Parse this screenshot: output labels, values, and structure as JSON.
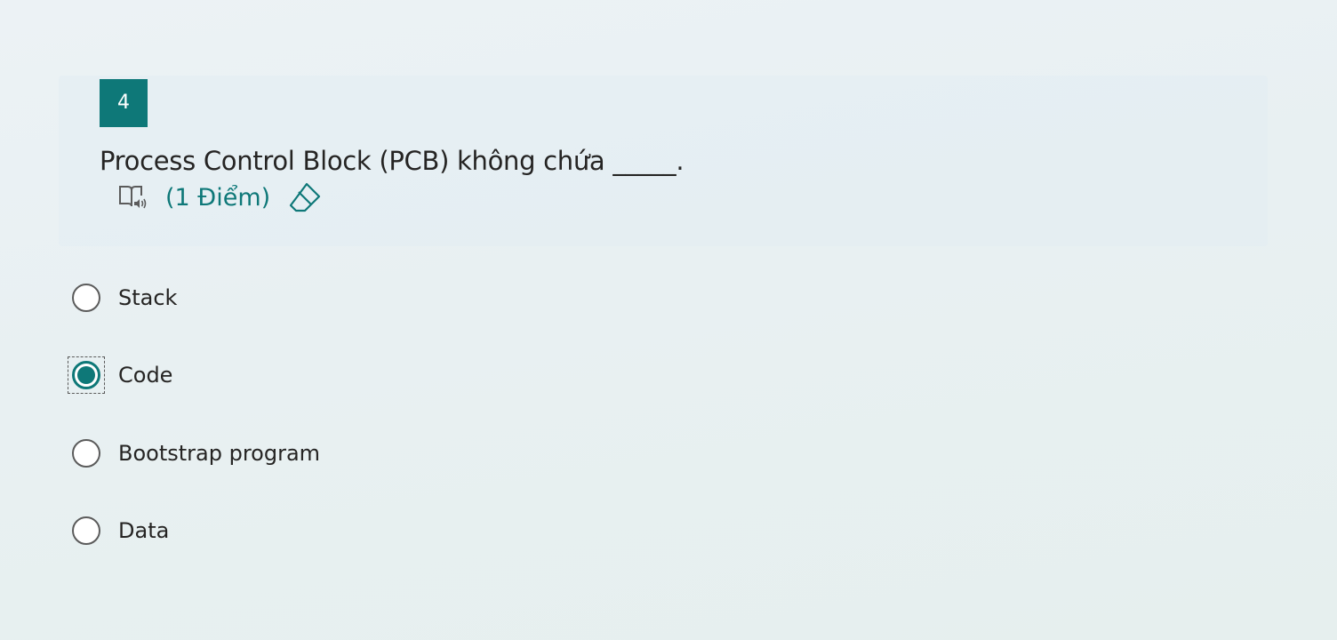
{
  "question": {
    "number": "4",
    "title": "Process Control Block (PCB) không chứa _____.",
    "points": "(1 Điểm)",
    "icons": [
      "immersive-reader-icon",
      "eraser-icon"
    ]
  },
  "options": [
    {
      "label": "Stack",
      "selected": false
    },
    {
      "label": "Code",
      "selected": true
    },
    {
      "label": "Bootstrap program",
      "selected": false
    },
    {
      "label": "Data",
      "selected": false
    }
  ],
  "colors": {
    "accent": "#0e7878",
    "text": "#252423",
    "radio_border": "#5b5b5b"
  }
}
